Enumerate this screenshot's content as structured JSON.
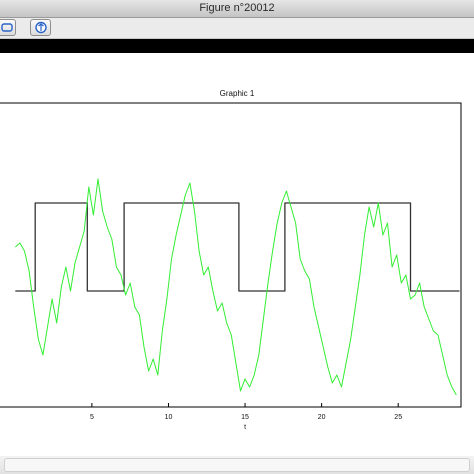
{
  "window": {
    "title": "Figure n°20012"
  },
  "toolbar": {
    "buttons": [
      {
        "icon": "rotate-icon"
      },
      {
        "icon": "zoom-icon"
      }
    ]
  },
  "colors": {
    "signal": "#33ee33",
    "square_wave": "#333333",
    "axis": "#000000"
  },
  "chart_data": {
    "type": "line",
    "title": "Graphic 1",
    "xlabel": "t",
    "ylabel": "",
    "xlim": [
      0,
      30
    ],
    "x_ticks": [
      5,
      10,
      15,
      20,
      25
    ],
    "series": [
      {
        "values_type": "square",
        "x": [
          0,
          1.3,
          1.3,
          4.7,
          4.7,
          7.1,
          7.1,
          14.6,
          14.6,
          17.6,
          17.6,
          25.8,
          25.8,
          29
        ],
        "y": [
          -0.5,
          -0.5,
          0.6,
          0.6,
          -0.5,
          -0.5,
          0.6,
          0.6,
          -0.5,
          -0.5,
          0.6,
          0.6,
          -0.5,
          -0.5
        ]
      },
      {
        "values_type": "signal",
        "x": [
          0,
          0.3,
          0.6,
          0.9,
          1.2,
          1.5,
          1.8,
          2.1,
          2.4,
          2.7,
          3.0,
          3.3,
          3.6,
          3.9,
          4.2,
          4.5,
          4.8,
          5.1,
          5.4,
          5.7,
          6.0,
          6.3,
          6.6,
          6.9,
          7.2,
          7.5,
          7.8,
          8.1,
          8.4,
          8.7,
          9.0,
          9.3,
          9.6,
          9.9,
          10.2,
          10.5,
          10.8,
          11.1,
          11.4,
          11.7,
          12.0,
          12.3,
          12.6,
          12.9,
          13.2,
          13.5,
          13.8,
          14.1,
          14.4,
          14.7,
          15.0,
          15.3,
          15.6,
          15.9,
          16.2,
          16.5,
          16.8,
          17.1,
          17.4,
          17.7,
          18.0,
          18.3,
          18.6,
          18.9,
          19.2,
          19.5,
          19.8,
          20.1,
          20.4,
          20.7,
          21.0,
          21.3,
          21.6,
          21.9,
          22.2,
          22.5,
          22.8,
          23.1,
          23.4,
          23.7,
          24.0,
          24.3,
          24.6,
          24.9,
          25.2,
          25.5,
          25.8,
          26.1,
          26.4,
          26.7,
          27.0,
          27.3,
          27.6,
          27.9,
          28.2,
          28.5,
          28.8
        ],
        "y": [
          0.05,
          0.1,
          0.0,
          -0.25,
          -0.7,
          -1.1,
          -1.3,
          -0.95,
          -0.6,
          -0.9,
          -0.45,
          -0.2,
          -0.5,
          -0.15,
          0.05,
          0.25,
          0.8,
          0.45,
          0.9,
          0.5,
          0.3,
          0.15,
          -0.2,
          -0.3,
          -0.55,
          -0.4,
          -0.7,
          -0.8,
          -1.2,
          -1.5,
          -1.35,
          -1.55,
          -1.0,
          -0.6,
          -0.1,
          0.2,
          0.45,
          0.7,
          0.85,
          0.5,
          0.0,
          -0.3,
          -0.2,
          -0.5,
          -0.75,
          -0.65,
          -0.9,
          -1.05,
          -1.4,
          -1.75,
          -1.6,
          -1.7,
          -1.55,
          -1.3,
          -0.85,
          -0.4,
          0.0,
          0.35,
          0.6,
          0.75,
          0.55,
          0.35,
          -0.1,
          -0.25,
          -0.35,
          -0.7,
          -0.95,
          -1.2,
          -1.45,
          -1.65,
          -1.55,
          -1.7,
          -1.4,
          -1.1,
          -0.7,
          -0.3,
          0.2,
          0.55,
          0.3,
          0.6,
          0.2,
          0.35,
          -0.2,
          -0.05,
          -0.4,
          -0.3,
          -0.6,
          -0.55,
          -0.4,
          -0.7,
          -0.85,
          -1.0,
          -1.05,
          -1.3,
          -1.55,
          -1.7,
          -1.8
        ]
      }
    ]
  }
}
